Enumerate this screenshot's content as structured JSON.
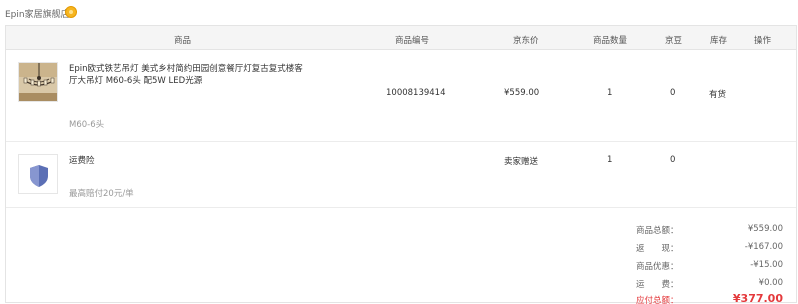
{
  "shop": {
    "name": "Epin家居旗舰店",
    "badge_icon": "gold-medal-icon"
  },
  "table": {
    "headers": {
      "product": "商品",
      "sku": "商品编号",
      "price": "京东价",
      "qty": "商品数量",
      "beans": "京豆",
      "stock": "库存",
      "ops": "操作"
    },
    "rows": [
      {
        "name": "Epin欧式铁艺吊灯 美式乡村简约田园创意餐厅灯复古复式楼客厅大吊灯 M60-6头 配5W LED光源",
        "spec": "M60-6头",
        "sku": "10008139414",
        "price": "¥559.00",
        "qty": "1",
        "beans": "0",
        "stock": "有货",
        "thumb_icon": "chandelier-image"
      },
      {
        "name": "运费险",
        "spec": "最高赔付20元/单",
        "sku": "",
        "price": "卖家赠送",
        "qty": "1",
        "beans": "0",
        "stock": "",
        "thumb_icon": "shield-icon"
      }
    ]
  },
  "summary": {
    "goods_total_label": "商品总额：",
    "goods_total": "¥559.00",
    "cashback_label": "返　　现：",
    "cashback": "-¥167.00",
    "discount_label": "商品优惠：",
    "discount": "-¥15.00",
    "shipping_label": "运　　费：",
    "shipping": "¥0.00",
    "payable_label": "应付总额：",
    "payable": "¥377.00"
  },
  "colors": {
    "accent_red": "#e4393c",
    "header_bg": "#f5f5f5",
    "shield_blue": "#5b6fb5"
  }
}
